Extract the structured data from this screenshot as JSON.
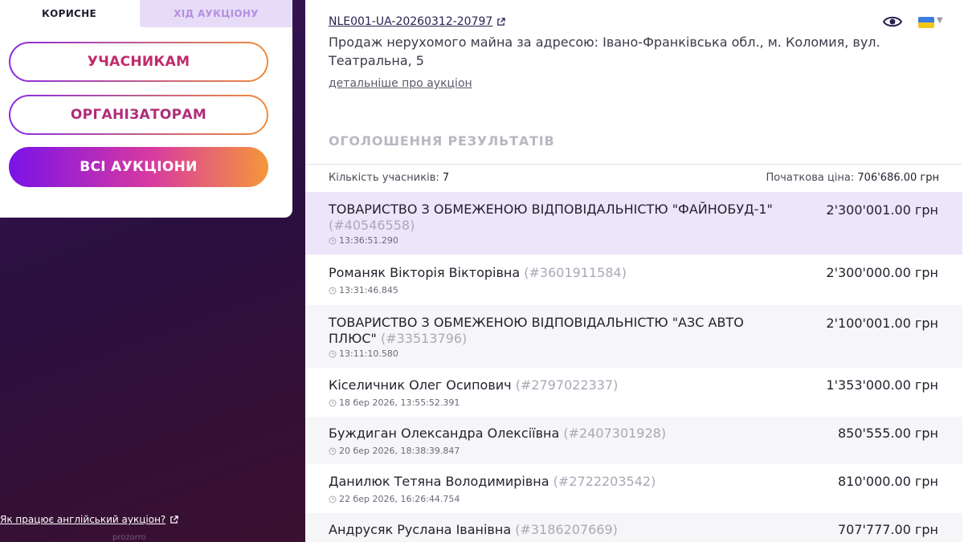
{
  "sidebar": {
    "tabs": {
      "useful": "КОРИСНЕ",
      "progress": "ХІД АУКЦІОНУ"
    },
    "buttons": {
      "participants": "УЧАСНИКАМ",
      "organizers": "ОРГАНІЗАТОРАМ",
      "all_auctions": "ВСІ АУКЦІОНИ"
    },
    "english_auction_link": "Як працює англійський аукціон?",
    "footer_faded": "prozorro"
  },
  "header": {
    "auction_id": "NLE001-UA-20260312-20797",
    "description": "Продаж нерухомого майна за адресою: Івано-Франківська обл., м. Коломия, вул. Театральна, 5",
    "more_link": "детальніше про аукціон"
  },
  "results": {
    "title": "ОГОЛОШЕННЯ РЕЗУЛЬТАТІВ",
    "participants_label": "Кількість учасників:",
    "participants_count": "7",
    "start_price_label": "Початкова ціна:",
    "start_price_value": "706'686.00 грн",
    "bids": [
      {
        "name": "ТОВАРИСТВО З ОБМЕЖЕНОЮ ВІДПОВІДАЛЬНІСТЮ \"ФАЙНОБУД-1\"",
        "code": "(#40546558)",
        "time": "13:36:51.290",
        "amount": "2'300'001.00 грн"
      },
      {
        "name": "Романяк Вікторія Вікторівна",
        "code": "(#3601911584)",
        "time": "13:31:46.845",
        "amount": "2'300'000.00 грн"
      },
      {
        "name": "ТОВАРИСТВО З ОБМЕЖЕНОЮ ВІДПОВІДАЛЬНІСТЮ \"АЗС АВТО ПЛЮС\"",
        "code": "(#33513796)",
        "time": "13:11:10.580",
        "amount": "2'100'001.00 грн"
      },
      {
        "name": "Кіселичник Олег Осипович",
        "code": "(#2797022337)",
        "time": "18 бер 2026, 13:55:52.391",
        "amount": "1'353'000.00 грн"
      },
      {
        "name": "Буждиган Олександра Олексіївна",
        "code": "(#2407301928)",
        "time": "20 бер 2026, 18:38:39.847",
        "amount": "850'555.00 грн"
      },
      {
        "name": "Данилюк Тетяна Володимирівна",
        "code": "(#2722203542)",
        "time": "22 бер 2026, 16:26:44.754",
        "amount": "810'000.00 грн"
      },
      {
        "name": "Андрусяк Руслана Іванівна",
        "code": "(#3186207669)",
        "time": "",
        "amount": "707'777.00 грн"
      }
    ]
  },
  "colors": {
    "accent_purple": "#7a12e8",
    "accent_orange": "#f5973a",
    "lead_row_bg": "#ede5f9",
    "sidebar_bg": "#2a0f40"
  },
  "icons": [
    "external-link-icon",
    "eye-icon",
    "ukraine-flag-icon",
    "chevron-down-icon",
    "clock-icon"
  ]
}
